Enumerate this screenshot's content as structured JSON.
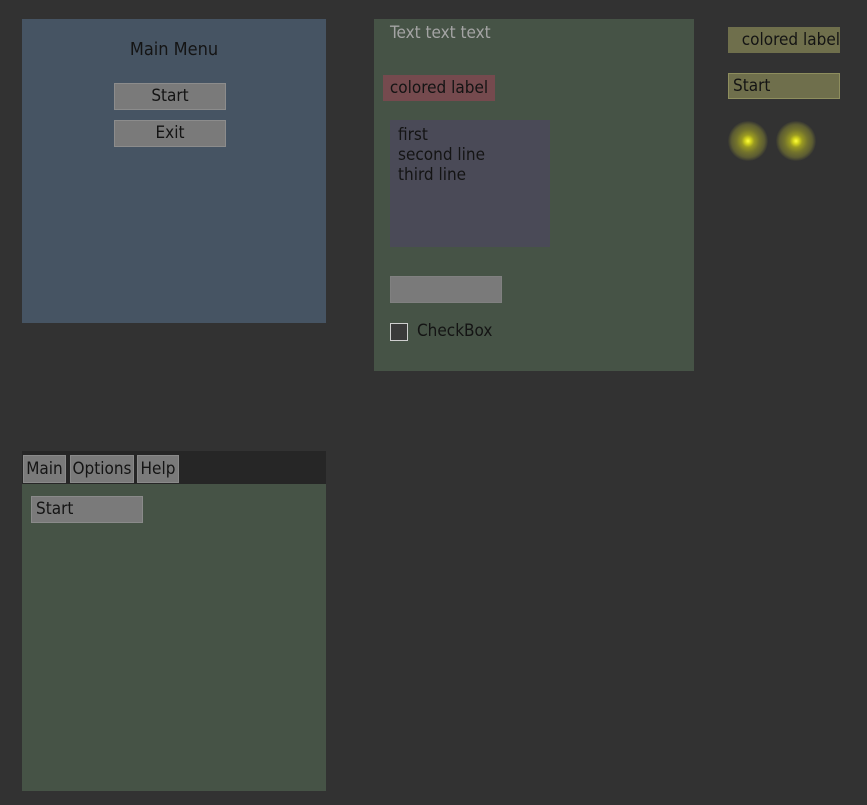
{
  "main_menu": {
    "title": "Main Menu",
    "buttons": [
      "Start",
      "Exit"
    ]
  },
  "middle_panel": {
    "text_label": "Text text text",
    "colored_label": "colored label",
    "list_items": [
      "first",
      "second line",
      "third line"
    ],
    "input_value": "",
    "checkbox": {
      "label": "CheckBox",
      "checked": false
    }
  },
  "right_column": {
    "colored_label": "colored label",
    "start_button": "Start",
    "icons": [
      "spark-icon",
      "spark-icon"
    ]
  },
  "bottom_panel": {
    "menu": [
      "Main",
      "Options",
      "Help"
    ],
    "start_button": "Start"
  },
  "colors": {
    "background": "#323232",
    "menu_panel": "#465463",
    "green_panel": "#465346",
    "red_label": "#754a4e",
    "yellow_label": "#6f6f4c",
    "listbox": "#4a4a57",
    "button": "#7a7a7a"
  }
}
